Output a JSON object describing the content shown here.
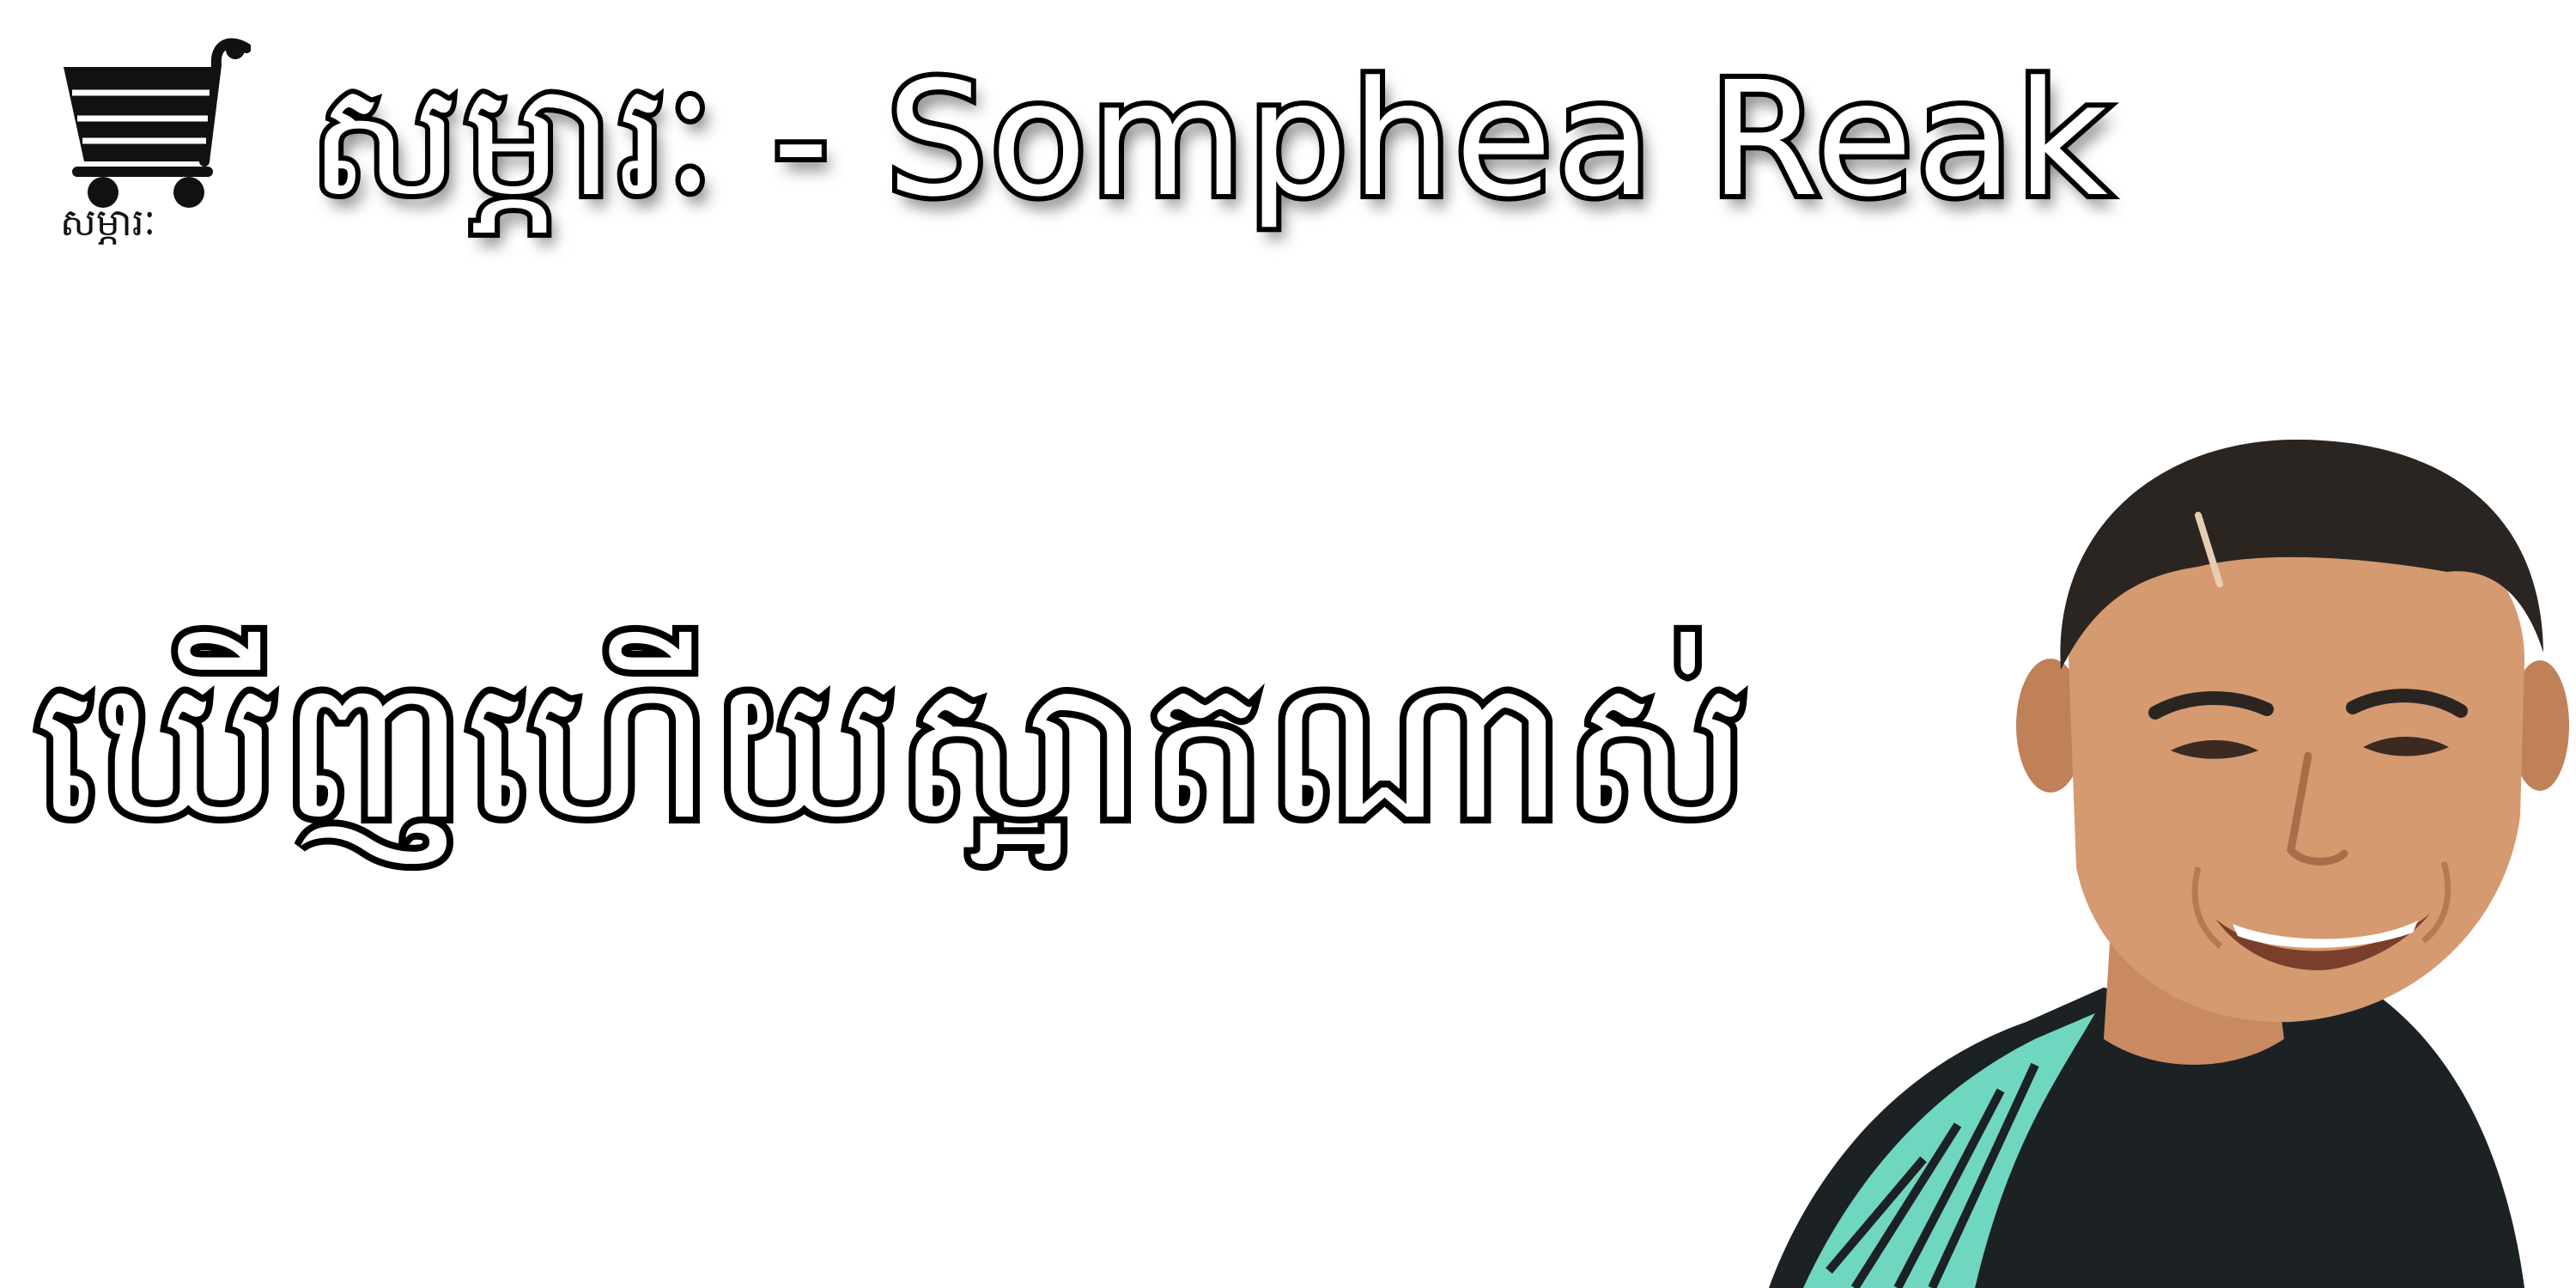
{
  "header": {
    "title": "សម្ភារៈ - Somphea Reak",
    "logo_caption": "សម្ភារៈ",
    "logo_icon": "shopping-cart-icon"
  },
  "main": {
    "caption": "ឃើញហើយស្អាតណាស់"
  },
  "colors": {
    "background": "#ffffff",
    "text_fill": "#ffffff",
    "text_outline": "#000000",
    "shirt_accent": "#6fd6bf"
  }
}
